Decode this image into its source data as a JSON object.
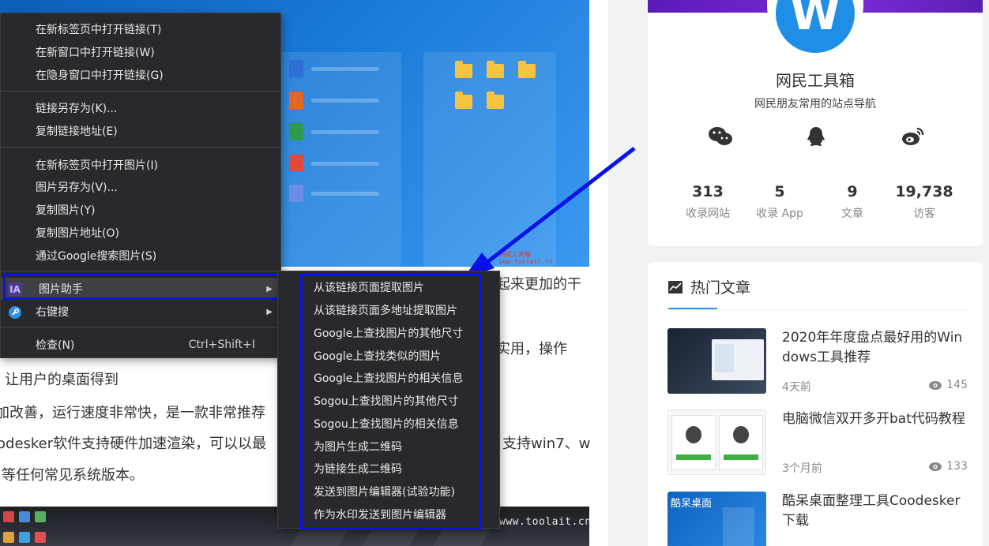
{
  "context_menu": {
    "items": [
      {
        "label": "在新标签页中打开链接(T)"
      },
      {
        "label": "在新窗口中打开链接(W)"
      },
      {
        "label": "在隐身窗口中打开链接(G)"
      },
      {
        "label": "链接另存为(K)..."
      },
      {
        "label": "复制链接地址(E)"
      },
      {
        "label": "在新标签页中打开图片(I)"
      },
      {
        "label": "图片另存为(V)..."
      },
      {
        "label": "复制图片(Y)"
      },
      {
        "label": "复制图片地址(O)"
      },
      {
        "label": "通过Google搜索图片(S)"
      },
      {
        "label": "图片助手",
        "icon": "IA"
      },
      {
        "label": "右键搜"
      },
      {
        "label": "检查(N)",
        "shortcut": "Ctrl+Shift+I"
      }
    ]
  },
  "submenu": {
    "items": [
      "从该链接页面提取图片",
      "从该链接页面多地址提取图片",
      "Google上查找图片的其他尺寸",
      "Google上查找类似的图片",
      "Google上查找图片的相关信息",
      "Sogou上查找图片的其他尺寸",
      "Sogou上查找图片的相关信息",
      "为图片生成二维码",
      "为链接生成二维码",
      "发送到图片编辑器(试验功能)",
      "作为水印发送到图片编辑器"
    ]
  },
  "article": {
    "text_lines": [
      "起来更加的干",
      "实用，操作",
      "让用户的桌面得到",
      "加改善，运行速度非常快，是一款非常推荐",
      "odesker软件支持硬件加速渲染，可以以最",
      "支持win7、w",
      "等任何常见系统版本。"
    ],
    "watermark_top": "网民工具箱\nwww.toolait.cn",
    "watermark_bottom": "www.toolait.cn"
  },
  "profile": {
    "avatar_letter": "W",
    "site_name": "网民工具箱",
    "site_desc": "网民朋友常用的站点导航",
    "social_icons": [
      "wechat-icon",
      "qq-icon",
      "weibo-icon"
    ],
    "stats": [
      {
        "value": "313",
        "label": "收录网站"
      },
      {
        "value": "5",
        "label": "收录 App"
      },
      {
        "value": "9",
        "label": "文章"
      },
      {
        "value": "19,738",
        "label": "访客"
      }
    ]
  },
  "hot_articles": {
    "title": "热门文章",
    "posts": [
      {
        "title": "2020年年度盘点最好用的Windows工具推荐",
        "time": "4天前",
        "views": "145"
      },
      {
        "title": "电脑微信双开多开bat代码教程",
        "time": "3个月前",
        "views": "133"
      },
      {
        "title": "酷呆桌面整理工具Coodesker下载",
        "time": "",
        "views": "",
        "thumb_text": "酷呆桌面"
      }
    ]
  },
  "colors": {
    "highlight_outline": "#0a12ea",
    "menu_bg": "#28292c",
    "accent_blue": "#2b8fea"
  }
}
